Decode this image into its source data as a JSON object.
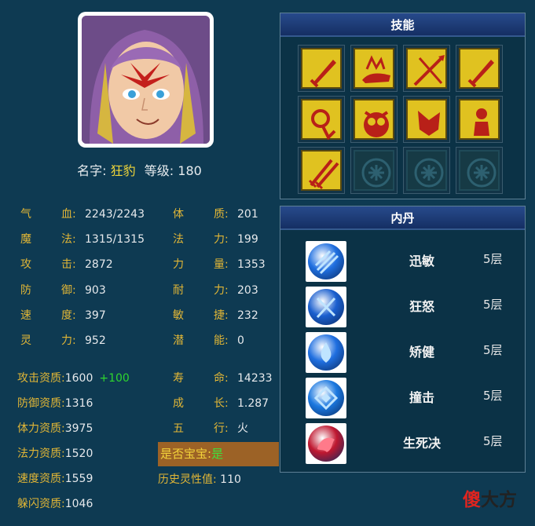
{
  "pet": {
    "name_label": "名字:",
    "name": "狂豹",
    "level_label": "等级:",
    "level": "180"
  },
  "stats_left": [
    {
      "c1": "气",
      "c2": "血:",
      "value": "2243/2243"
    },
    {
      "c1": "魔",
      "c2": "法:",
      "value": "1315/1315"
    },
    {
      "c1": "攻",
      "c2": "击:",
      "value": "2872"
    },
    {
      "c1": "防",
      "c2": "御:",
      "value": "903"
    },
    {
      "c1": "速",
      "c2": "度:",
      "value": "397"
    },
    {
      "c1": "灵",
      "c2": "力:",
      "value": "952"
    }
  ],
  "stats_right": [
    {
      "c1": "体",
      "c2": "质:",
      "value": "201"
    },
    {
      "c1": "法",
      "c2": "力:",
      "value": "199"
    },
    {
      "c1": "力",
      "c2": "量:",
      "value": "1353"
    },
    {
      "c1": "耐",
      "c2": "力:",
      "value": "203"
    },
    {
      "c1": "敏",
      "c2": "捷:",
      "value": "232"
    },
    {
      "c1": "潜",
      "c2": "能:",
      "value": "0"
    }
  ],
  "aptitude_left": [
    {
      "label": "攻击资质:",
      "value": "1600",
      "bonus": "+100"
    },
    {
      "label": "防御资质:",
      "value": "1316"
    },
    {
      "label": "体力资质:",
      "value": "3975"
    },
    {
      "label": "法力资质:",
      "value": "1520"
    },
    {
      "label": "速度资质:",
      "value": "1559"
    },
    {
      "label": "躲闪资质:",
      "value": "1046"
    }
  ],
  "aptitude_right": [
    {
      "c1": "寿",
      "c2": "命:",
      "value": "14233"
    },
    {
      "c1": "成",
      "c2": "长:",
      "value": "1.287"
    },
    {
      "c1": "五",
      "c2": "行:",
      "value": "火"
    }
  ],
  "baby": {
    "label": "是否宝宝:",
    "value": "是"
  },
  "history": {
    "label": "历史灵性值:",
    "value": "110"
  },
  "skills": {
    "title": "技能",
    "icons": [
      "sword-skill-icon",
      "beast-skill-icon",
      "spear-skill-icon",
      "sword-skill-icon",
      "magic-skill-icon",
      "owl-skill-icon",
      "shield-skill-icon",
      "figure-skill-icon",
      "dual-sword-skill-icon",
      "empty-slot-icon",
      "empty-slot-icon",
      "empty-slot-icon"
    ]
  },
  "neidan": {
    "title": "内丹",
    "items": [
      {
        "name": "迅敏",
        "level": "5层",
        "icon": "claw-orb-icon"
      },
      {
        "name": "狂怒",
        "level": "5层",
        "icon": "blades-orb-icon"
      },
      {
        "name": "矫健",
        "level": "5层",
        "icon": "drop-orb-icon"
      },
      {
        "name": "撞击",
        "level": "5层",
        "icon": "diamond-orb-icon"
      },
      {
        "name": "生死决",
        "level": "5层",
        "icon": "dragon-orb-icon"
      }
    ]
  },
  "watermark": {
    "part1": "傻",
    "part2": "大方"
  },
  "colors": {
    "panel_bg": "#0e3a52",
    "label_gold": "#e1b636",
    "value_white": "#e6e9ec",
    "bonus_green": "#2ed62e",
    "skill_yellow": "#e0c220",
    "title_blue": "#1c3d7a"
  }
}
